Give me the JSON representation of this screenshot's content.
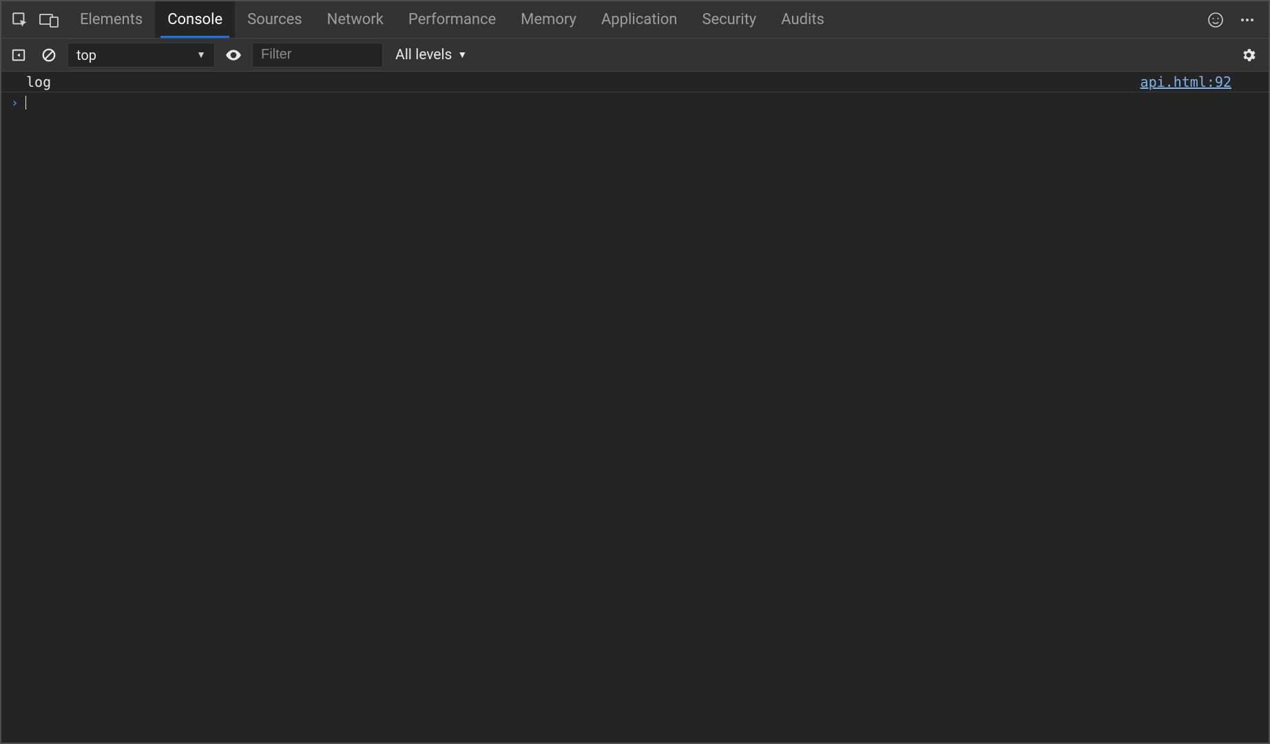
{
  "tabs": {
    "items": [
      {
        "label": "Elements"
      },
      {
        "label": "Console"
      },
      {
        "label": "Sources"
      },
      {
        "label": "Network"
      },
      {
        "label": "Performance"
      },
      {
        "label": "Memory"
      },
      {
        "label": "Application"
      },
      {
        "label": "Security"
      },
      {
        "label": "Audits"
      }
    ],
    "active_index": 1
  },
  "console_toolbar": {
    "context": "top",
    "filter_placeholder": "Filter",
    "filter_value": "",
    "levels_label": "All levels"
  },
  "console": {
    "rows": [
      {
        "message": "log",
        "source": "api.html:92"
      }
    ]
  },
  "icons": {
    "inspect": "inspect-icon",
    "device": "device-icon",
    "feedback": "smile-icon",
    "more": "more-icon",
    "sidebar": "sidebar-toggle-icon",
    "clear": "clear-icon",
    "eye": "eye-icon",
    "gear": "gear-icon"
  }
}
